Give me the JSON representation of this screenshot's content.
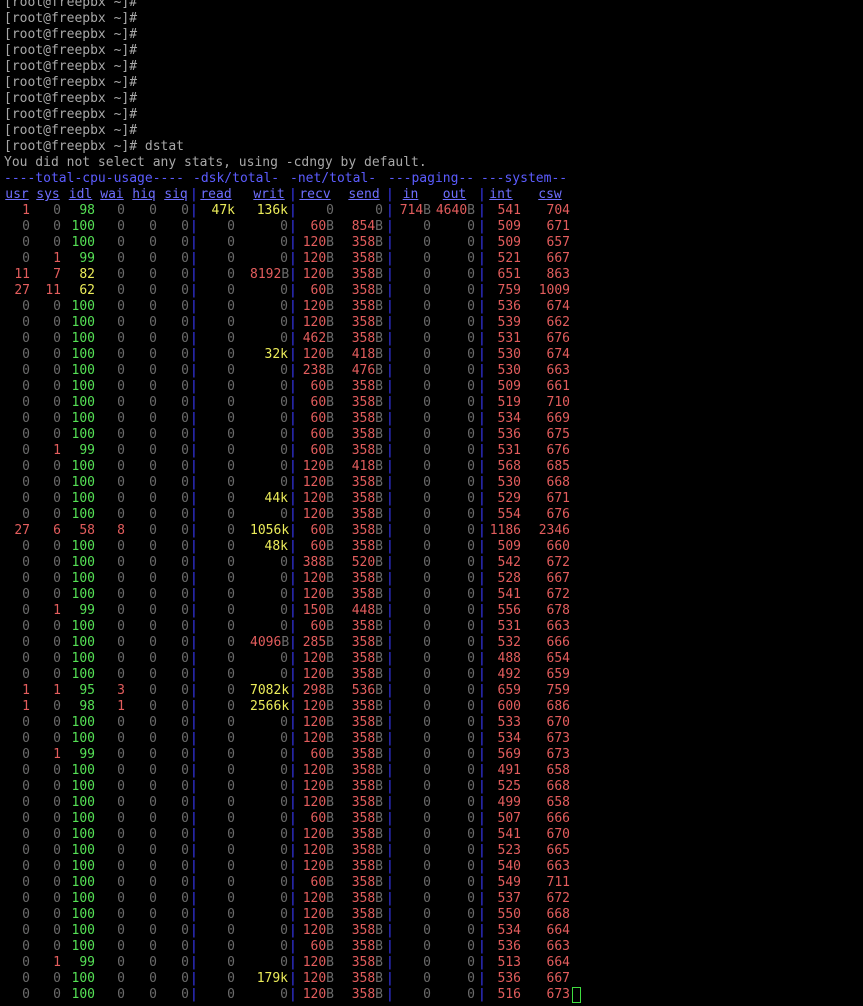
{
  "prompts": [
    "[root@freepbx ~]#",
    "[root@freepbx ~]#",
    "[root@freepbx ~]#",
    "[root@freepbx ~]#",
    "[root@freepbx ~]#",
    "[root@freepbx ~]#",
    "[root@freepbx ~]#",
    "[root@freepbx ~]#",
    "[root@freepbx ~]#",
    "[root@freepbx ~]# dstat"
  ],
  "message": "You did not select any stats, using -cdngy by default.",
  "group_headers": [
    "----total-cpu-usage----",
    "-dsk/total-",
    "-net/total-",
    "---paging--",
    "---system--"
  ],
  "column_headers": [
    "usr",
    "sys",
    "idl",
    "wai",
    "hiq",
    "siq",
    "read",
    "writ",
    "recv",
    "send",
    "in",
    "out",
    "int",
    "csw"
  ],
  "colors": {
    "background": "#000000",
    "text": "#a8a8a8",
    "header_blue": "#6f6fff",
    "low": "#55e055",
    "mid": "#ecec5a",
    "high": "#e35d5d",
    "cursor": "#3fdc3f"
  },
  "rows": [
    [
      "1",
      "0",
      "98",
      "0",
      "0",
      "0",
      "47k",
      "136k",
      "0",
      "0",
      "714B",
      "4640B",
      "541",
      "704"
    ],
    [
      "0",
      "0",
      "100",
      "0",
      "0",
      "0",
      "0",
      "0",
      "60B",
      "854B",
      "0",
      "0",
      "509",
      "671"
    ],
    [
      "0",
      "0",
      "100",
      "0",
      "0",
      "0",
      "0",
      "0",
      "120B",
      "358B",
      "0",
      "0",
      "509",
      "657"
    ],
    [
      "0",
      "1",
      "99",
      "0",
      "0",
      "0",
      "0",
      "0",
      "120B",
      "358B",
      "0",
      "0",
      "521",
      "667"
    ],
    [
      "11",
      "7",
      "82",
      "0",
      "0",
      "0",
      "0",
      "8192B",
      "120B",
      "358B",
      "0",
      "0",
      "651",
      "863"
    ],
    [
      "27",
      "11",
      "62",
      "0",
      "0",
      "0",
      "0",
      "0",
      "60B",
      "358B",
      "0",
      "0",
      "759",
      "1009"
    ],
    [
      "0",
      "0",
      "100",
      "0",
      "0",
      "0",
      "0",
      "0",
      "120B",
      "358B",
      "0",
      "0",
      "536",
      "674"
    ],
    [
      "0",
      "0",
      "100",
      "0",
      "0",
      "0",
      "0",
      "0",
      "120B",
      "358B",
      "0",
      "0",
      "539",
      "662"
    ],
    [
      "0",
      "0",
      "100",
      "0",
      "0",
      "0",
      "0",
      "0",
      "462B",
      "358B",
      "0",
      "0",
      "531",
      "676"
    ],
    [
      "0",
      "0",
      "100",
      "0",
      "0",
      "0",
      "0",
      "32k",
      "120B",
      "418B",
      "0",
      "0",
      "530",
      "674"
    ],
    [
      "0",
      "0",
      "100",
      "0",
      "0",
      "0",
      "0",
      "0",
      "238B",
      "476B",
      "0",
      "0",
      "530",
      "663"
    ],
    [
      "0",
      "0",
      "100",
      "0",
      "0",
      "0",
      "0",
      "0",
      "60B",
      "358B",
      "0",
      "0",
      "509",
      "661"
    ],
    [
      "0",
      "0",
      "100",
      "0",
      "0",
      "0",
      "0",
      "0",
      "60B",
      "358B",
      "0",
      "0",
      "519",
      "710"
    ],
    [
      "0",
      "0",
      "100",
      "0",
      "0",
      "0",
      "0",
      "0",
      "60B",
      "358B",
      "0",
      "0",
      "534",
      "669"
    ],
    [
      "0",
      "0",
      "100",
      "0",
      "0",
      "0",
      "0",
      "0",
      "60B",
      "358B",
      "0",
      "0",
      "536",
      "675"
    ],
    [
      "0",
      "1",
      "99",
      "0",
      "0",
      "0",
      "0",
      "0",
      "60B",
      "358B",
      "0",
      "0",
      "531",
      "676"
    ],
    [
      "0",
      "0",
      "100",
      "0",
      "0",
      "0",
      "0",
      "0",
      "120B",
      "418B",
      "0",
      "0",
      "568",
      "685"
    ],
    [
      "0",
      "0",
      "100",
      "0",
      "0",
      "0",
      "0",
      "0",
      "120B",
      "358B",
      "0",
      "0",
      "530",
      "668"
    ],
    [
      "0",
      "0",
      "100",
      "0",
      "0",
      "0",
      "0",
      "44k",
      "120B",
      "358B",
      "0",
      "0",
      "529",
      "671"
    ],
    [
      "0",
      "0",
      "100",
      "0",
      "0",
      "0",
      "0",
      "0",
      "120B",
      "358B",
      "0",
      "0",
      "554",
      "676"
    ],
    [
      "27",
      "6",
      "58",
      "8",
      "0",
      "0",
      "0",
      "1056k",
      "60B",
      "358B",
      "0",
      "0",
      "1186",
      "2346"
    ],
    [
      "0",
      "0",
      "100",
      "0",
      "0",
      "0",
      "0",
      "48k",
      "60B",
      "358B",
      "0",
      "0",
      "509",
      "660"
    ],
    [
      "0",
      "0",
      "100",
      "0",
      "0",
      "0",
      "0",
      "0",
      "388B",
      "520B",
      "0",
      "0",
      "542",
      "672"
    ],
    [
      "0",
      "0",
      "100",
      "0",
      "0",
      "0",
      "0",
      "0",
      "120B",
      "358B",
      "0",
      "0",
      "528",
      "667"
    ],
    [
      "0",
      "0",
      "100",
      "0",
      "0",
      "0",
      "0",
      "0",
      "120B",
      "358B",
      "0",
      "0",
      "541",
      "672"
    ],
    [
      "0",
      "1",
      "99",
      "0",
      "0",
      "0",
      "0",
      "0",
      "150B",
      "448B",
      "0",
      "0",
      "556",
      "678"
    ],
    [
      "0",
      "0",
      "100",
      "0",
      "0",
      "0",
      "0",
      "0",
      "60B",
      "358B",
      "0",
      "0",
      "531",
      "663"
    ],
    [
      "0",
      "0",
      "100",
      "0",
      "0",
      "0",
      "0",
      "4096B",
      "285B",
      "358B",
      "0",
      "0",
      "532",
      "666"
    ],
    [
      "0",
      "0",
      "100",
      "0",
      "0",
      "0",
      "0",
      "0",
      "120B",
      "358B",
      "0",
      "0",
      "488",
      "654"
    ],
    [
      "0",
      "0",
      "100",
      "0",
      "0",
      "0",
      "0",
      "0",
      "120B",
      "358B",
      "0",
      "0",
      "492",
      "659"
    ],
    [
      "1",
      "1",
      "95",
      "3",
      "0",
      "0",
      "0",
      "7082k",
      "298B",
      "536B",
      "0",
      "0",
      "659",
      "759"
    ],
    [
      "1",
      "0",
      "98",
      "1",
      "0",
      "0",
      "0",
      "2566k",
      "120B",
      "358B",
      "0",
      "0",
      "600",
      "686"
    ],
    [
      "0",
      "0",
      "100",
      "0",
      "0",
      "0",
      "0",
      "0",
      "120B",
      "358B",
      "0",
      "0",
      "533",
      "670"
    ],
    [
      "0",
      "0",
      "100",
      "0",
      "0",
      "0",
      "0",
      "0",
      "120B",
      "358B",
      "0",
      "0",
      "534",
      "673"
    ],
    [
      "0",
      "1",
      "99",
      "0",
      "0",
      "0",
      "0",
      "0",
      "60B",
      "358B",
      "0",
      "0",
      "569",
      "673"
    ],
    [
      "0",
      "0",
      "100",
      "0",
      "0",
      "0",
      "0",
      "0",
      "120B",
      "358B",
      "0",
      "0",
      "491",
      "658"
    ],
    [
      "0",
      "0",
      "100",
      "0",
      "0",
      "0",
      "0",
      "0",
      "120B",
      "358B",
      "0",
      "0",
      "525",
      "668"
    ],
    [
      "0",
      "0",
      "100",
      "0",
      "0",
      "0",
      "0",
      "0",
      "120B",
      "358B",
      "0",
      "0",
      "499",
      "658"
    ],
    [
      "0",
      "0",
      "100",
      "0",
      "0",
      "0",
      "0",
      "0",
      "60B",
      "358B",
      "0",
      "0",
      "507",
      "666"
    ],
    [
      "0",
      "0",
      "100",
      "0",
      "0",
      "0",
      "0",
      "0",
      "120B",
      "358B",
      "0",
      "0",
      "541",
      "670"
    ],
    [
      "0",
      "0",
      "100",
      "0",
      "0",
      "0",
      "0",
      "0",
      "120B",
      "358B",
      "0",
      "0",
      "523",
      "665"
    ],
    [
      "0",
      "0",
      "100",
      "0",
      "0",
      "0",
      "0",
      "0",
      "120B",
      "358B",
      "0",
      "0",
      "540",
      "663"
    ],
    [
      "0",
      "0",
      "100",
      "0",
      "0",
      "0",
      "0",
      "0",
      "60B",
      "358B",
      "0",
      "0",
      "549",
      "711"
    ],
    [
      "0",
      "0",
      "100",
      "0",
      "0",
      "0",
      "0",
      "0",
      "120B",
      "358B",
      "0",
      "0",
      "537",
      "672"
    ],
    [
      "0",
      "0",
      "100",
      "0",
      "0",
      "0",
      "0",
      "0",
      "120B",
      "358B",
      "0",
      "0",
      "550",
      "668"
    ],
    [
      "0",
      "0",
      "100",
      "0",
      "0",
      "0",
      "0",
      "0",
      "120B",
      "358B",
      "0",
      "0",
      "534",
      "664"
    ],
    [
      "0",
      "0",
      "100",
      "0",
      "0",
      "0",
      "0",
      "0",
      "60B",
      "358B",
      "0",
      "0",
      "536",
      "663"
    ],
    [
      "0",
      "1",
      "99",
      "0",
      "0",
      "0",
      "0",
      "0",
      "120B",
      "358B",
      "0",
      "0",
      "513",
      "664"
    ],
    [
      "0",
      "0",
      "100",
      "0",
      "0",
      "0",
      "0",
      "179k",
      "120B",
      "358B",
      "0",
      "0",
      "536",
      "667"
    ],
    [
      "0",
      "0",
      "100",
      "0",
      "0",
      "0",
      "0",
      "0",
      "120B",
      "358B",
      "0",
      "0",
      "516",
      "673"
    ]
  ]
}
